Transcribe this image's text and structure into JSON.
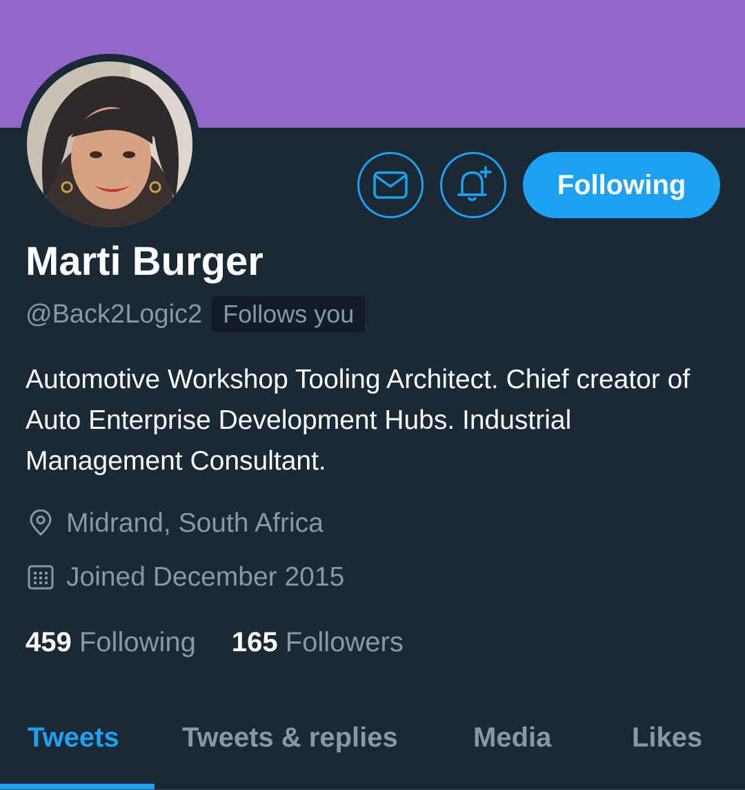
{
  "banner": {
    "color": "#9366cc"
  },
  "actions": {
    "message_icon": "envelope-icon",
    "notify_icon": "bell-plus-icon",
    "follow_label": "Following"
  },
  "profile": {
    "name": "Marti Burger",
    "handle": "@Back2Logic2",
    "follows_you": "Follows you",
    "bio": "Automotive Workshop Tooling Architect. Chief creator of Auto Enterprise Development Hubs. Industrial Management Consultant.",
    "location": "Midrand, South Africa",
    "joined": "Joined December 2015"
  },
  "stats": {
    "following_count": "459",
    "following_label": "Following",
    "followers_count": "165",
    "followers_label": "Followers"
  },
  "tabs": [
    {
      "label": "Tweets",
      "active": true
    },
    {
      "label": "Tweets & replies",
      "active": false
    },
    {
      "label": "Media",
      "active": false
    },
    {
      "label": "Likes",
      "active": false
    }
  ],
  "colors": {
    "background": "#1b2836",
    "accent": "#1da1f2",
    "secondary_text": "#8899a6"
  }
}
